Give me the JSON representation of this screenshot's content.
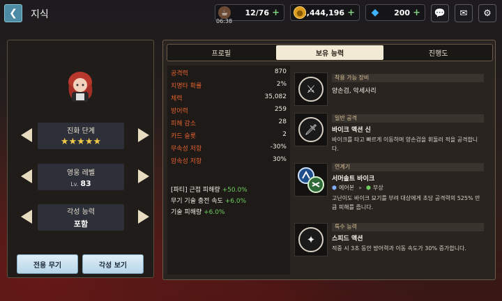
{
  "header": {
    "back_icon": "arrow-left-icon",
    "title": "지식",
    "stamina": {
      "icon": "coffee-cup-icon",
      "value": "12/76",
      "timer": "06:38"
    },
    "gold": {
      "icon": "gold-coin-icon",
      "value": "2,444,196"
    },
    "gems": {
      "icon": "gem-icon",
      "value": "200"
    },
    "plus": "+",
    "chat_icon": "chat-bubble-icon",
    "mail_icon": "mail-icon",
    "settings_icon": "gear-icon"
  },
  "left": {
    "evolution": {
      "label": "진화 단계",
      "stars": "★★★★★"
    },
    "level": {
      "label": "영웅 레벨",
      "prefix": "Lv.",
      "value": "83"
    },
    "awakening": {
      "label": "각성 능력",
      "value": "포함"
    },
    "exclusive_weapon_btn": "전용 무기",
    "awakening_view_btn": "각성 보기"
  },
  "tabs": [
    "프로필",
    "보유 능력",
    "진행도"
  ],
  "active_tab": 1,
  "stats": [
    {
      "name": "공격력",
      "value": "870"
    },
    {
      "name": "치명타 확률",
      "value": "2%"
    },
    {
      "name": "체력",
      "value": "35,082"
    },
    {
      "name": "방어력",
      "value": "259"
    },
    {
      "name": "피해 감소",
      "value": "28"
    },
    {
      "name": "카드 슬롯",
      "value": "2"
    },
    {
      "name": "무속성 저항",
      "value": "-30%"
    },
    {
      "name": "암속성 저항",
      "value": "30%"
    }
  ],
  "bonuses": [
    {
      "label": "[파티] 근접 피해량",
      "value": "+50.0%"
    },
    {
      "label": "무기 기술 충전 속도",
      "value": "+6.0%"
    },
    {
      "label": "기술 피해량",
      "value": "+6.0%"
    }
  ],
  "skills": {
    "equip": {
      "category": "착용 가능 장비",
      "name": "양손검, 악세사리",
      "icon": "sword-shield-icon"
    },
    "normal": {
      "category": "일반 공격",
      "name": "바이크 액션 신",
      "desc": "바이크를 타고 빠르게 이동하며 양손검을 휘둘러 적을 공격합니다.",
      "icon": "sword-icon"
    },
    "chain": {
      "category": "연계기",
      "name": "서머솔트 바이크",
      "from": "에어본",
      "to": "부상",
      "desc": "고난이도 바이크 묘기를 부려 대상에게 초당 공격력의 525% 만큼 피해를 줍니다.",
      "icon": "chain-skill-icon"
    },
    "special": {
      "category": "특수 능력",
      "name": "스피드 액션",
      "desc": "적중 시 3초 동안 방어력과 이동 속도가 30% 증가합니다.",
      "icon": "sparkle-icon"
    }
  }
}
